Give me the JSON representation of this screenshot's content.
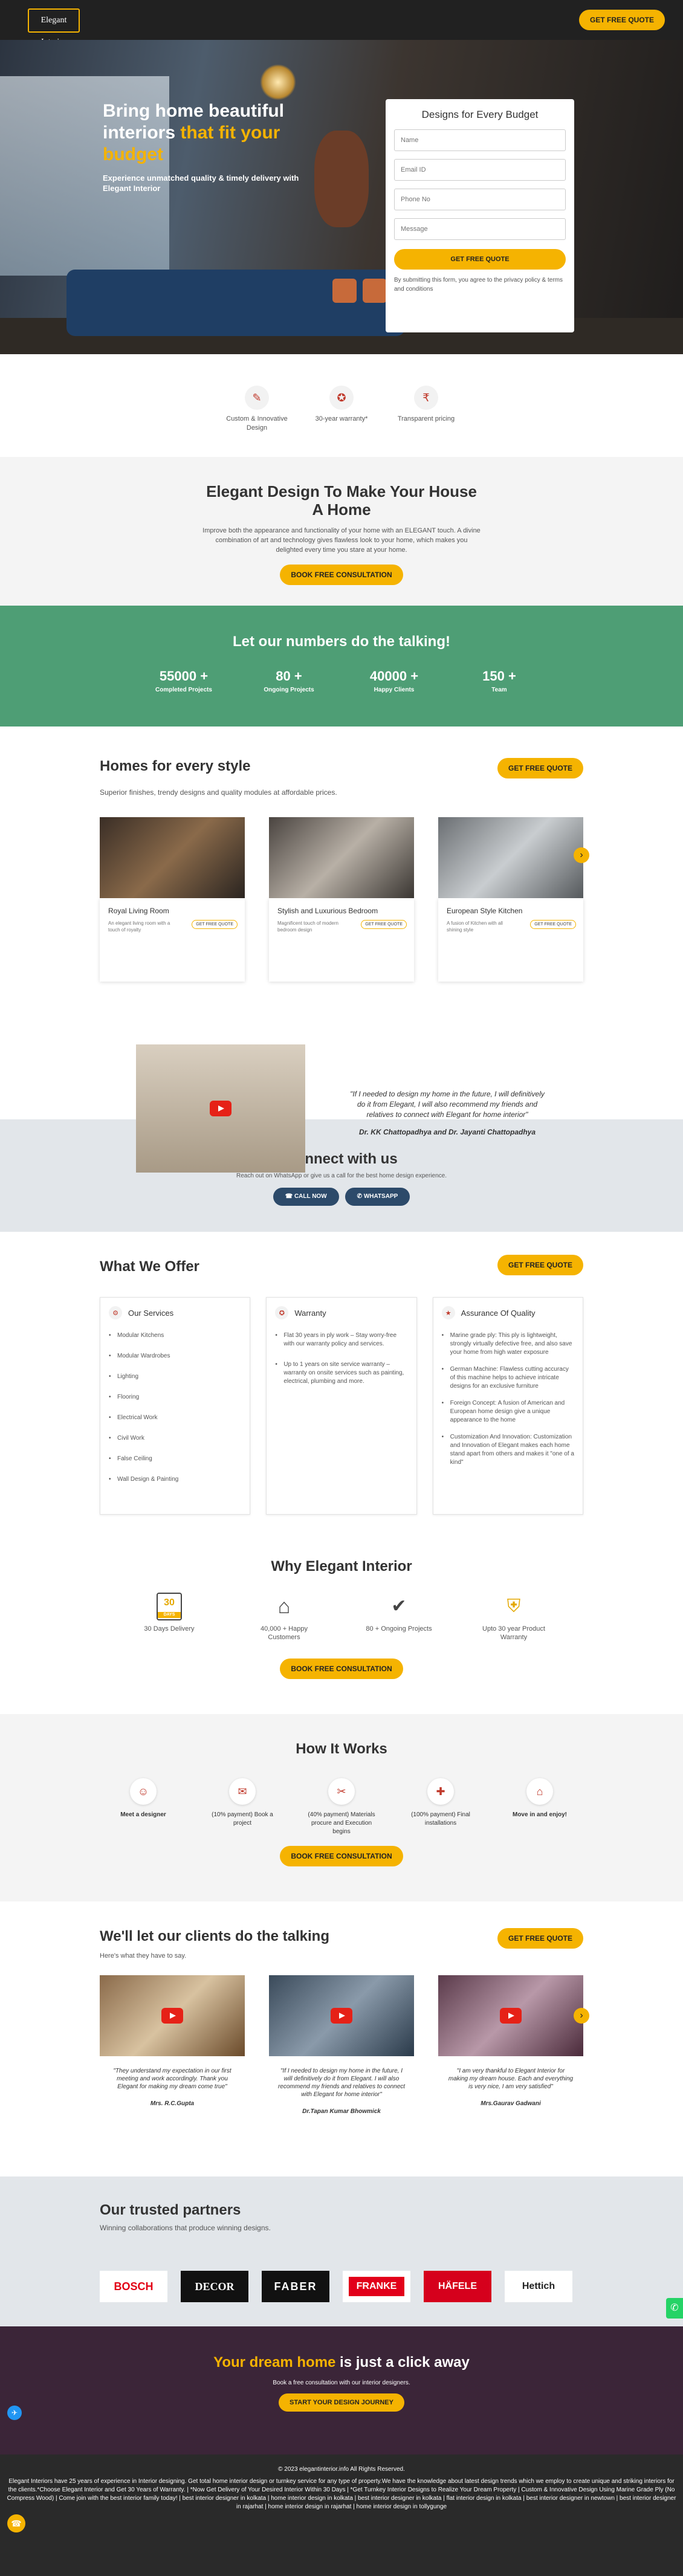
{
  "header": {
    "logo": "Elegant Interior",
    "cta": "GET FREE QUOTE"
  },
  "hero": {
    "headline_1": "Bring home beautiful interiors ",
    "headline_2": "that fit your budget",
    "subtext": "Experience unmatched quality & timely delivery with Elegant Interior",
    "form": {
      "title": "Designs for Every Budget",
      "name_placeholder": "Name",
      "email_placeholder": "Email ID",
      "phone_placeholder": "Phone No",
      "message_placeholder": "Message",
      "submit": "GET FREE QUOTE",
      "note": "By submitting this form, you agree to the privacy policy & terms and conditions"
    }
  },
  "features": [
    {
      "label": "Custom & Innovative Design",
      "icon": "design-icon"
    },
    {
      "label": "30-year warranty*",
      "icon": "warranty-icon"
    },
    {
      "label": "Transparent pricing",
      "icon": "pricing-icon"
    }
  ],
  "design_section": {
    "title": "Elegant Design To Make Your House A Home",
    "text": "Improve both the appearance and functionality of your home with an ELEGANT touch. A divine combination of art and technology gives flawless look to your home, which makes you delighted every time you stare at your home.",
    "cta": "BOOK FREE CONSULTATION"
  },
  "numbers": {
    "title": "Let our numbers do the talking!",
    "items": [
      {
        "value": "55000 +",
        "label": "Completed Projects"
      },
      {
        "value": "80 +",
        "label": "Ongoing Projects"
      },
      {
        "value": "40000 +",
        "label": "Happy Clients"
      },
      {
        "value": "150 +",
        "label": "Team"
      }
    ]
  },
  "homes": {
    "title": "Homes for every style",
    "subtitle": "Superior finishes, trendy designs and quality modules at affordable prices.",
    "cta": "GET FREE QUOTE",
    "cards": [
      {
        "title": "Royal Living Room",
        "desc": "An elegant living room with a touch of royalty",
        "cta": "GET FREE QUOTE"
      },
      {
        "title": "Stylish and Luxurious Bedroom",
        "desc": "Magnificent touch of modern bedroom design",
        "cta": "GET FREE QUOTE"
      },
      {
        "title": "European Style Kitchen",
        "desc": "A fusion of Kitchen with all shining style",
        "cta": "GET FREE QUOTE"
      }
    ],
    "testimonial": {
      "quote": "\"If I needed to design my home in the future, I will definitively do it from Elegant, I will also recommend my friends and relatives to connect with Elegant for home interior\"",
      "author": "Dr. KK Chattopadhya and Dr. Jayanti Chattopadhya"
    }
  },
  "connect": {
    "title": "Connect with us",
    "text": "Reach out on WhatsApp or give us a call for the best home design experience.",
    "call": "CALL NOW",
    "whatsapp": "WHATSAPP"
  },
  "offer": {
    "title": "What We Offer",
    "cta": "GET FREE QUOTE",
    "columns": [
      {
        "title": "Our Services",
        "items": [
          "Modular Kitchens",
          "Modular Wardrobes",
          "Lighting",
          "Flooring",
          "Electrical Work",
          "Civil Work",
          "False Ceiling",
          "Wall Design & Painting"
        ]
      },
      {
        "title": "Warranty",
        "items": [
          "Flat 30 years in ply work – Stay worry-free with our warranty policy and services.",
          "Up to 1 years on site service warranty – warranty on onsite services such as painting, electrical, plumbing and more."
        ]
      },
      {
        "title": "Assurance Of Quality",
        "items": [
          "Marine grade ply: This ply is lightweight, strongly virtually defective free, and also save your home from high water exposure",
          "German Machine: Flawless cutting accuracy of this machine helps to achieve intricate designs for an exclusive furniture",
          "Foreign Concept: A fusion of American and European home design give a unique appearance to the home",
          "Customization And Innovation: Customization and Innovation of Elegant makes each home stand apart from others and makes it \"one of a kind\""
        ]
      }
    ]
  },
  "why": {
    "title": "Why Elegant Interior",
    "items": [
      {
        "label": "30 Days Delivery",
        "icon": "calendar-icon",
        "icon_text": "30"
      },
      {
        "label": "40,000 + Happy Customers",
        "icon": "house-icon"
      },
      {
        "label": "80 + Ongoing Projects",
        "icon": "badge-icon"
      },
      {
        "label": "Upto 30 year Product Warranty",
        "icon": "shield-icon"
      }
    ],
    "cta": "BOOK FREE CONSULTATION"
  },
  "how": {
    "title": "How It Works",
    "steps": [
      {
        "label": "Meet a designer",
        "icon": "designer-icon"
      },
      {
        "label": "(10% payment) Book a project",
        "icon": "booking-icon"
      },
      {
        "label": "(40% payment) Materials procure and Execution begins",
        "icon": "tools-icon"
      },
      {
        "label": "(100% payment) Final installations",
        "icon": "install-icon"
      },
      {
        "label": "Move in and enjoy!",
        "icon": "home-icon"
      }
    ],
    "cta": "BOOK FREE CONSULTATION"
  },
  "talk": {
    "title": "We'll let our clients do the talking",
    "subtitle": "Here's what they have to say.",
    "cta": "GET FREE QUOTE",
    "videos": [
      {
        "quote": "\"They understand my expectation in our first meeting and work accordingly. Thank you Elegant for making my dream come true\"",
        "author": "Mrs. R.C.Gupta"
      },
      {
        "quote": "\"If I needed to design my home in the future, I will definitively do it from Elegant. I will also recommend my friends and relatives to connect with Elegant for home interior\"",
        "author": "Dr.Tapan Kumar Bhowmick"
      },
      {
        "quote": "\"I am very thankful to Elegant Interior for making my dream house. Each and everything is very nice, I am very satisfied\"",
        "author": "Mrs.Gaurav Gadwani"
      }
    ]
  },
  "partners": {
    "title": "Our trusted partners",
    "subtitle": "Winning collaborations that produce winning designs.",
    "logos": [
      "BOSCH",
      "DECOR",
      "FABER",
      "FRANKE",
      "HÄFELE",
      "Hettich"
    ]
  },
  "dream": {
    "title_accent": "Your dream home",
    "title_rest": " is just a click away",
    "text": "Book a free consultation with our interior designers.",
    "cta": "START YOUR DESIGN JOURNEY"
  },
  "footer": {
    "copyright": "© 2023 elegantinterior.info All Rights Reserved.",
    "text": "Elegant Interiors have 25 years of experience in Interior designing. Get total home interior design or turnkey service for any type of property.We have the knowledge about latest design trends which we employ to create unique and striking interiors for the clients.*Choose Elegant Interior and Get 30 Years of Warranty. | *Now Get Delivery of Your Desired Interior Within 30 Days | *Get Turnkey Interior Designs to Realize Your Dream Property | Custom & Innovative Design Using Marine Grade Ply (No Compress Wood) | Come join with the best interior family today! | best interior designer in kolkata | home interior design in kolkata | best interior designer in kolkata | flat interior design in kolkata | best interior designer in newtown | best interior designer in rajarhat | home interior design in rajarhat | home interior design in tollygunge"
  },
  "colors": {
    "accent": "#f5b301",
    "green": "#4e9e75",
    "dark": "#212121",
    "plum": "#3b2538"
  }
}
